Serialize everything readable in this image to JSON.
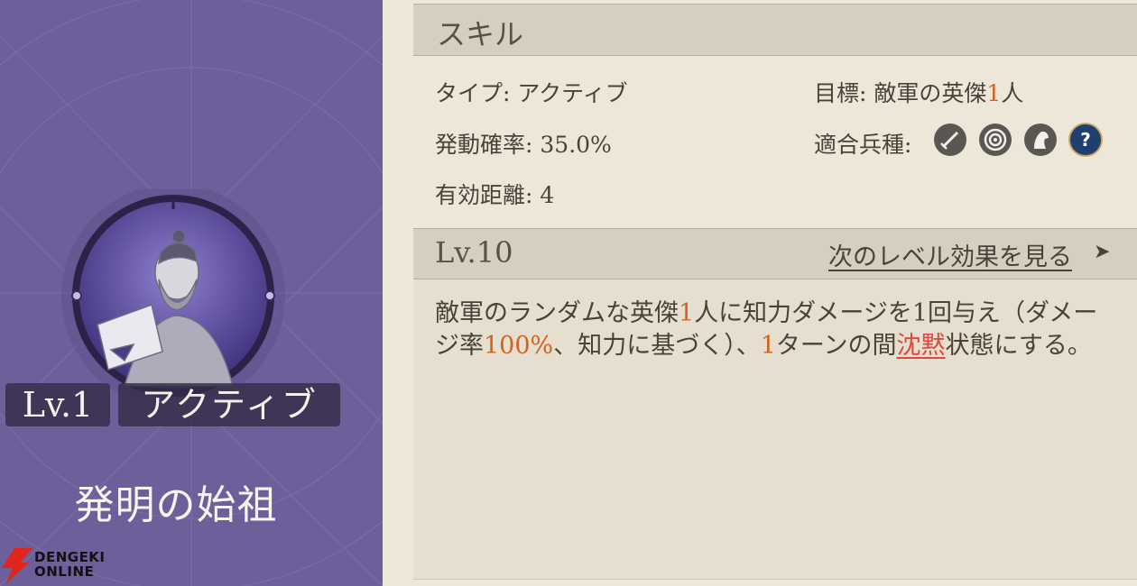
{
  "card": {
    "level_label": "Lv.1",
    "type_label": "アクティブ",
    "skill_name": "発明の始祖",
    "background_color": "#6c5f9a"
  },
  "logo": {
    "line1": "DENGEKI",
    "line2": "ONLINE"
  },
  "skill_panel": {
    "header": "スキル",
    "type": {
      "label": "タイプ:",
      "value": "アクティブ"
    },
    "target": {
      "label": "目標:",
      "value_prefix": "敵軍の英傑",
      "count": "1",
      "value_suffix": "人"
    },
    "activation_rate": {
      "label": "発動確率:",
      "value": "35.0%"
    },
    "troop_types": {
      "label": "適合兵種:",
      "icons": [
        "sword-icon",
        "bow-target-icon",
        "horse-icon",
        "question-mark-icon"
      ]
    },
    "range": {
      "label": "有効距離:",
      "value": "4"
    }
  },
  "level_panel": {
    "level": "Lv.10",
    "next_level_link": "次のレベル効果を見る",
    "arrow": "➤"
  },
  "description": {
    "p1": "敵軍のランダムな英傑",
    "n1": "1",
    "p2": "人に知力ダメージを1回与え（ダメージ率",
    "n2": "100%",
    "p3": "、知力に基づく）、",
    "n3": "1",
    "p4": "ターンの間",
    "status": "沈黙",
    "p5": "状態にする。"
  },
  "colors": {
    "highlight": "#d4621f",
    "status_highlight": "#e0483c"
  }
}
